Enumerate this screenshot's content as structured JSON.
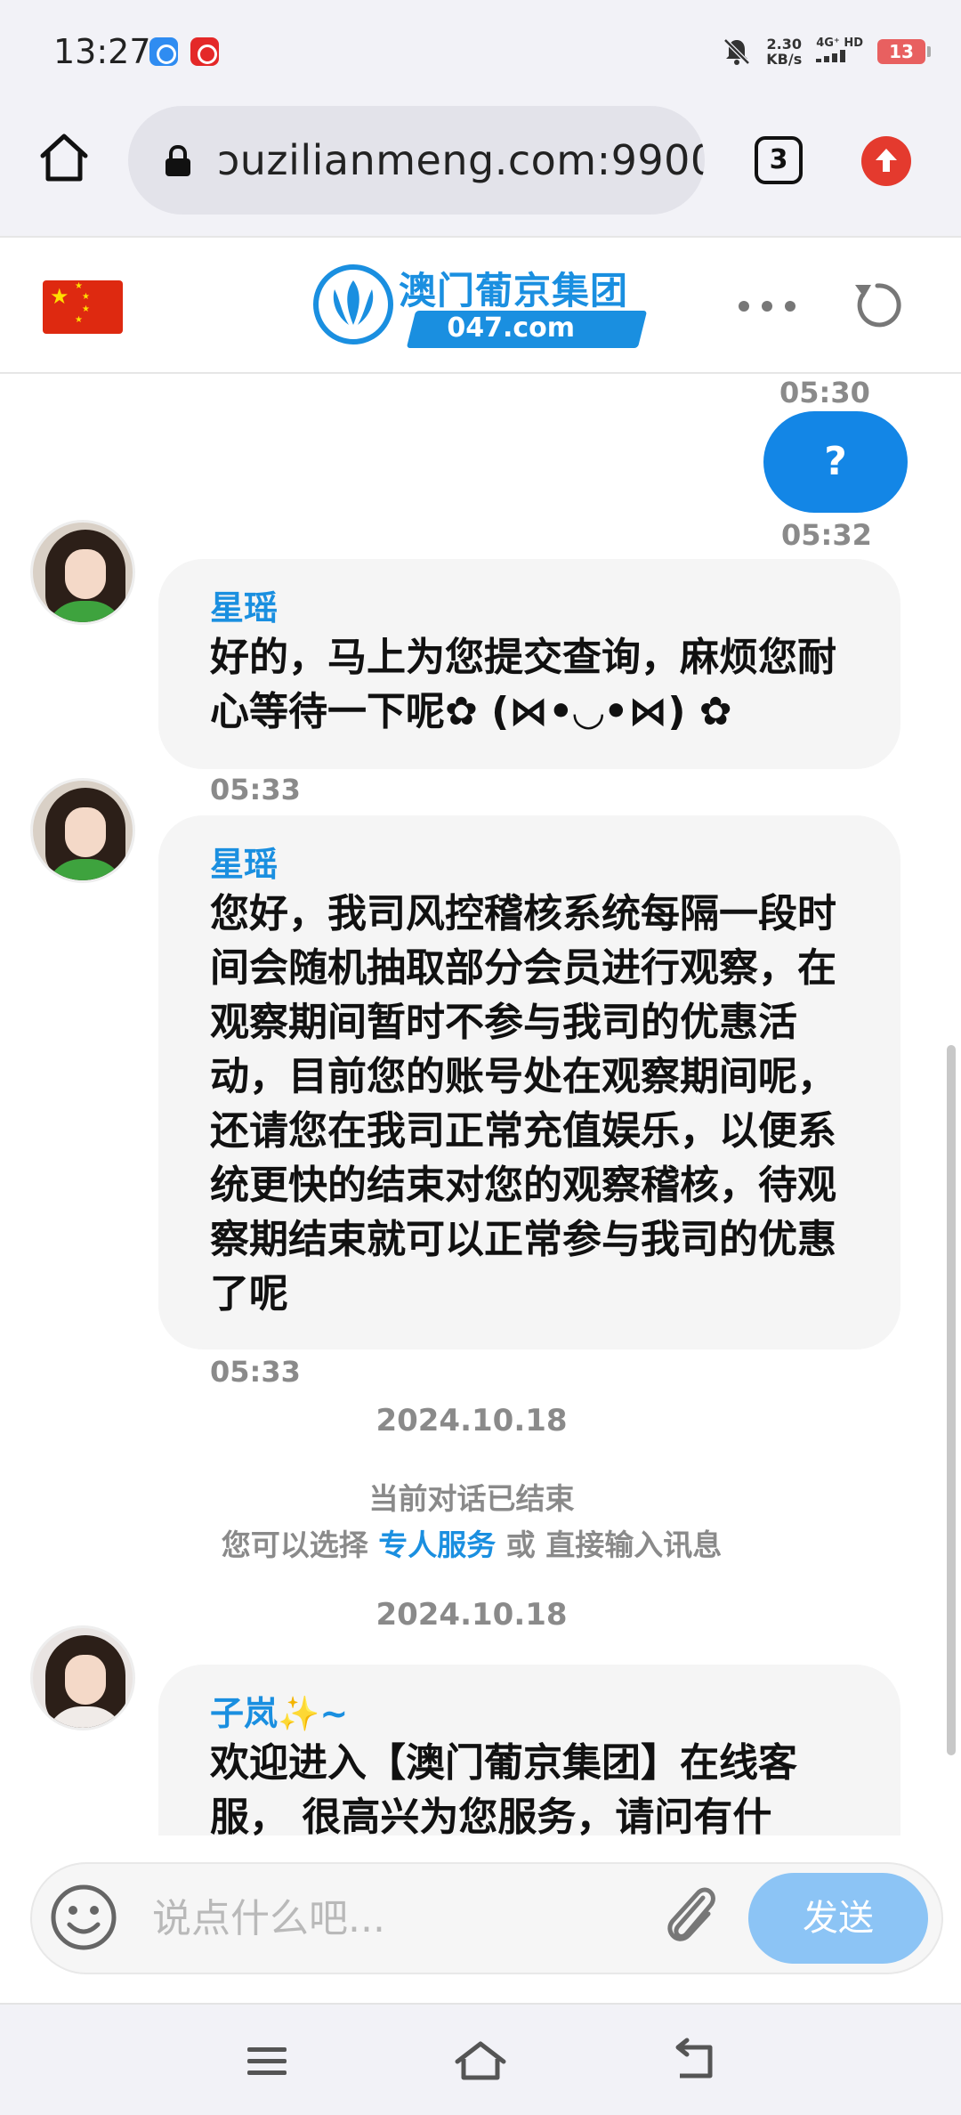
{
  "status_bar": {
    "time": "13:27",
    "net_speed_value": "2.30",
    "net_speed_unit": "KB/s",
    "network": "4G⁺ HD",
    "battery": "13"
  },
  "browser": {
    "url": "ɔuzilianmeng.com:9900",
    "tab_count": "3"
  },
  "site": {
    "logo_name": "澳门葡京集团",
    "logo_domain": "047.com"
  },
  "chat": {
    "user_message": {
      "time_above": "05:30",
      "text": "?",
      "time_below": "05:32"
    },
    "messages": [
      {
        "sender": "星瑶",
        "text": "好的，马上为您提交查询，麻烦您耐心等待一下呢✿ (⋈•◡•⋈) ✿",
        "time": "05:33"
      },
      {
        "sender": "星瑶",
        "text": "您好，我司风控稽核系统每隔一段时间会随机抽取部分会员进行观察，在观察期间暂时不参与我司的优惠活动，目前您的账号处在观察期间呢，还请您在我司正常充值娱乐，以便系统更快的结束对您的观察稽核，待观察期结束就可以正常参与我司的优惠了呢",
        "time": "05:33"
      }
    ],
    "date_1": "2024.10.18",
    "ended_notice": "当前对话已结束",
    "choice_prefix": "您可以选择",
    "choice_link": "专人服务",
    "choice_mid": "或",
    "choice_suffix": "直接输入讯息",
    "date_2": "2024.10.18",
    "welcome": {
      "sender": "子岚✨~",
      "text": "欢迎进入【澳门葡京集团】在线客服， 很高兴为您服务，请问有什"
    }
  },
  "input": {
    "placeholder": "说点什么吧...",
    "send_label": "发送"
  },
  "colors": {
    "accent": "#1a8fe0",
    "user_bubble": "#1386e6",
    "send_button": "#8cc4f5"
  }
}
